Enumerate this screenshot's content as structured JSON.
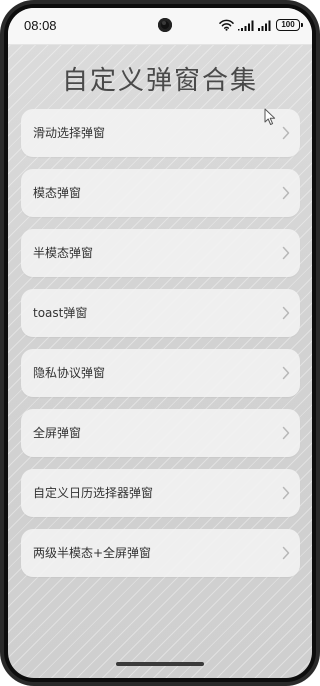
{
  "status_bar": {
    "time": "08:08",
    "battery": "100",
    "icons": [
      "wifi-icon",
      "signal-icon",
      "signal-icon",
      "battery-icon"
    ]
  },
  "page": {
    "title": "自定义弹窗合集"
  },
  "menu": {
    "items": [
      {
        "label": "滑动选择弹窗"
      },
      {
        "label": "模态弹窗"
      },
      {
        "label": "半模态弹窗"
      },
      {
        "label": "toast弹窗"
      },
      {
        "label": "隐私协议弹窗"
      },
      {
        "label": "全屏弹窗"
      },
      {
        "label": "自定义日历选择器弹窗"
      },
      {
        "label": "两级半模态+全屏弹窗"
      }
    ],
    "chevron_icon": "chevron-right-icon"
  },
  "colors": {
    "background": "#d4d4d4",
    "card": "#f3f3f3",
    "title": "#4a4a4a",
    "text": "#333333",
    "chevron": "#b8b8b8"
  }
}
